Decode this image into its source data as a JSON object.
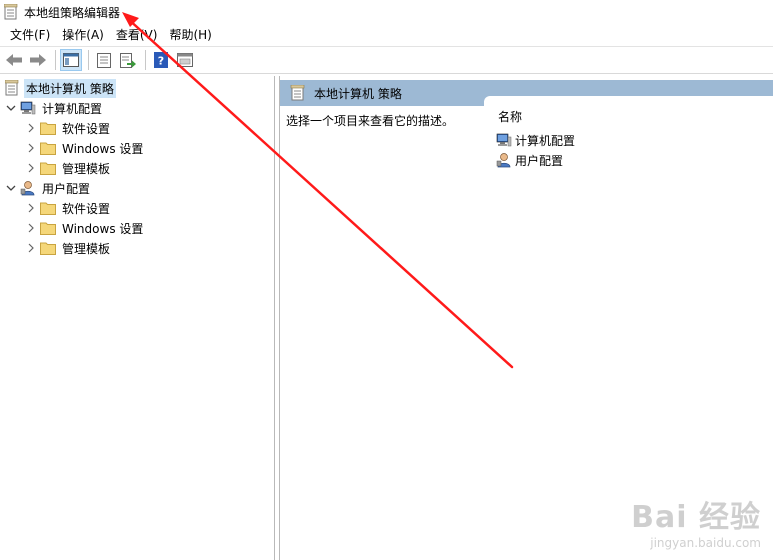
{
  "window": {
    "title": "本地组策略编辑器"
  },
  "menu": [
    {
      "label": "文件(F)"
    },
    {
      "label": "操作(A)"
    },
    {
      "label": "查看(V)"
    },
    {
      "label": "帮助(H)"
    }
  ],
  "toolbar": {
    "icons": [
      "back-arrow-icon",
      "forward-arrow-icon",
      "show-tree-icon",
      "properties-icon",
      "export-list-icon",
      "help-icon",
      "console-view-icon"
    ]
  },
  "tree": {
    "root": "本地计算机 策略",
    "computer_config": "计算机配置",
    "user_config": "用户配置",
    "computer_children": [
      "软件设置",
      "Windows 设置",
      "管理模板"
    ],
    "user_children": [
      "软件设置",
      "Windows 设置",
      "管理模板"
    ]
  },
  "right": {
    "header_title": "本地计算机 策略",
    "description": "选择一个项目来查看它的描述。",
    "column_name": "名称",
    "items": [
      "计算机配置",
      "用户配置"
    ]
  },
  "watermark": {
    "main": "Bai 经验",
    "sub": "jingyan.baidu.com"
  },
  "colors": {
    "header_bg": "#9db9d4",
    "selected_bg": "#cce4f7",
    "annotation": "#ff1a1a"
  }
}
